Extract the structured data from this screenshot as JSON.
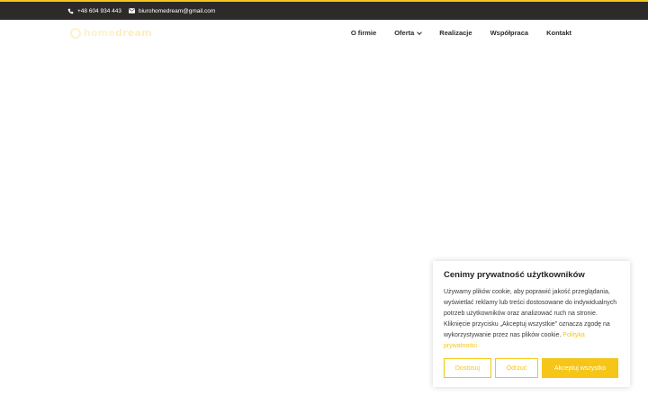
{
  "topbar": {
    "phone": "+48 604 934 443",
    "email": "biurohomedream@gmail.com",
    "phone_icon": "phone-icon",
    "email_icon": "envelope-icon"
  },
  "logo": {
    "part1": "home",
    "part2": "dream"
  },
  "nav": {
    "items": [
      {
        "label": "O firmie"
      },
      {
        "label": "Oferta",
        "has_dropdown": true
      },
      {
        "label": "Realizacje"
      },
      {
        "label": "Współpraca"
      },
      {
        "label": "Kontakt"
      }
    ]
  },
  "cookie": {
    "title": "Cenimy prywatność użytkowników",
    "text": "Używamy plików cookie, aby poprawić jakość przeglądania, wyświetlać reklamy lub treści dostosowane do indywidualnych potrzeb użytkowników oraz analizować ruch na stronie. Kliknięcie przycisku „Akceptuj wszystkie” oznacza zgodę na wykorzystywanie przez nas plików cookie.",
    "link": "Polityka prywatności",
    "btn_customize": "Dostosuj",
    "btn_reject": "Odrzuć",
    "btn_accept": "Akceptuj wszystko"
  },
  "colors": {
    "accent": "#f5c518",
    "topbar_bg": "#2d2b2a"
  }
}
